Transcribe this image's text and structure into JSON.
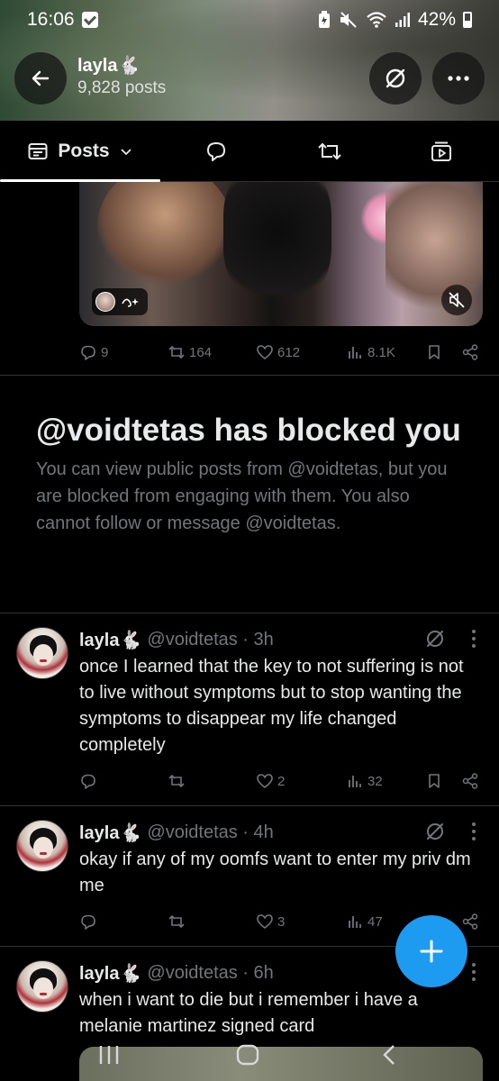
{
  "status_bar": {
    "time": "16:06",
    "battery": "42%"
  },
  "header": {
    "name": "layla🐇",
    "posts_count": "9,828 posts"
  },
  "tabs": [
    {
      "label": "Posts",
      "active": true,
      "icon": "timeline-icon"
    },
    {
      "label": "",
      "icon": "reply-bubble-icon"
    },
    {
      "label": "",
      "icon": "repost-icon"
    },
    {
      "label": "",
      "icon": "media-play-icon"
    }
  ],
  "media_post": {
    "actions": {
      "replies": "9",
      "reposts": "164",
      "likes": "612",
      "views": "8.1K"
    }
  },
  "blocked_notice": {
    "title": "@voidtetas has blocked you",
    "description": "You can view public posts from @voidtetas, but you are blocked from engaging with them. You also cannot follow or message @voidtetas."
  },
  "tweets": [
    {
      "name": "layla🐇",
      "handle": "@voidtetas · 3h",
      "text": "once I learned that the key to not suffering is not to live without symptoms but to stop wanting the symptoms to disappear my life changed completely",
      "replies": "",
      "reposts": "",
      "likes": "2",
      "views": "32"
    },
    {
      "name": "layla🐇",
      "handle": "@voidtetas · 4h",
      "text": "okay if any of my oomfs want to enter my priv dm me",
      "replies": "",
      "reposts": "",
      "likes": "3",
      "views": "47"
    },
    {
      "name": "layla🐇",
      "handle": "@voidtetas · 6h",
      "text": "when i want to die but i remember i have a melanie martinez signed card"
    }
  ],
  "colors": {
    "background": "#000000",
    "text_primary": "#e7e9ea",
    "text_secondary": "#71767b",
    "accent": "#1d9bf0",
    "divider": "#2f3336"
  }
}
